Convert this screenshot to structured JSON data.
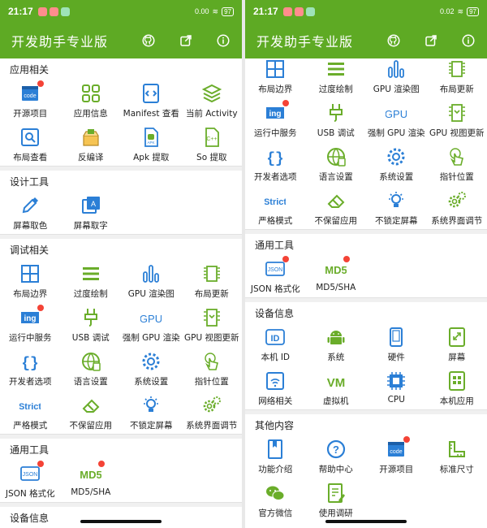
{
  "status_bar": {
    "time": "21:17",
    "battery": "97",
    "speed_left": "0.00",
    "speed_right": "0.02"
  },
  "app": {
    "title": "开发助手专业版"
  },
  "colors": {
    "brand": "#5eaa24",
    "blue": "#2b7fd6",
    "green": "#6aad2a",
    "red": "#f44336"
  },
  "icons": {
    "github": "github-icon",
    "share": "share-icon",
    "info": "info-icon"
  },
  "left": {
    "sections": [
      {
        "title": "应用相关",
        "items": [
          {
            "label": "开源项目",
            "icon": "code"
          },
          {
            "label": "应用信息",
            "icon": "grid"
          },
          {
            "label": "Manifest 查看",
            "icon": "manifest"
          },
          {
            "label": "当前 Activity",
            "icon": "layers"
          },
          {
            "label": "布局查看",
            "icon": "search"
          },
          {
            "label": "反编译",
            "icon": "box"
          },
          {
            "label": "Apk 提取",
            "icon": "apk"
          },
          {
            "label": "So 提取",
            "icon": "cpp"
          }
        ]
      },
      {
        "title": "设计工具",
        "items": [
          {
            "label": "屏幕取色",
            "icon": "picker"
          },
          {
            "label": "屏幕取字",
            "icon": "textpick"
          }
        ]
      },
      {
        "title": "调试相关",
        "items": [
          {
            "label": "布局边界",
            "icon": "bounds"
          },
          {
            "label": "过度绘制",
            "icon": "bars"
          },
          {
            "label": "GPU 渲染图",
            "icon": "gpuchart"
          },
          {
            "label": "布局更新",
            "icon": "layoutupdate"
          },
          {
            "label": "运行中服务",
            "icon": "ing"
          },
          {
            "label": "USB 调试",
            "icon": "usb"
          },
          {
            "label": "强制 GPU 渲染",
            "icon": "gpu"
          },
          {
            "label": "GPU 视图更新",
            "icon": "gpuview"
          },
          {
            "label": "开发者选项",
            "icon": "braces"
          },
          {
            "label": "语言设置",
            "icon": "globe"
          },
          {
            "label": "系统设置",
            "icon": "gear"
          },
          {
            "label": "指针位置",
            "icon": "pointer"
          },
          {
            "label": "严格模式",
            "icon": "strict"
          },
          {
            "label": "不保留应用",
            "icon": "eraser"
          },
          {
            "label": "不锁定屏幕",
            "icon": "bulb"
          },
          {
            "label": "系统界面调节",
            "icon": "gears"
          }
        ]
      },
      {
        "title": "通用工具",
        "items": [
          {
            "label": "JSON 格式化",
            "icon": "json"
          },
          {
            "label": "MD5/SHA",
            "icon": "md5"
          }
        ]
      },
      {
        "title": "设备信息",
        "items": []
      }
    ]
  },
  "right": {
    "sections": [
      {
        "title": "",
        "items": [
          {
            "label": "布局边界",
            "icon": "bounds"
          },
          {
            "label": "过度绘制",
            "icon": "bars"
          },
          {
            "label": "GPU 渲染图",
            "icon": "gpuchart"
          },
          {
            "label": "布局更新",
            "icon": "layoutupdate"
          },
          {
            "label": "运行中服务",
            "icon": "ing"
          },
          {
            "label": "USB 调试",
            "icon": "usb"
          },
          {
            "label": "强制 GPU 渲染",
            "icon": "gpu"
          },
          {
            "label": "GPU 视图更新",
            "icon": "gpuview"
          },
          {
            "label": "开发者选项",
            "icon": "braces"
          },
          {
            "label": "语言设置",
            "icon": "globe"
          },
          {
            "label": "系统设置",
            "icon": "gear"
          },
          {
            "label": "指针位置",
            "icon": "pointer"
          },
          {
            "label": "严格模式",
            "icon": "strict"
          },
          {
            "label": "不保留应用",
            "icon": "eraser"
          },
          {
            "label": "不锁定屏幕",
            "icon": "bulb"
          },
          {
            "label": "系统界面调节",
            "icon": "gears"
          }
        ]
      },
      {
        "title": "通用工具",
        "items": [
          {
            "label": "JSON 格式化",
            "icon": "json"
          },
          {
            "label": "MD5/SHA",
            "icon": "md5"
          }
        ]
      },
      {
        "title": "设备信息",
        "items": [
          {
            "label": "本机 ID",
            "icon": "id"
          },
          {
            "label": "系统",
            "icon": "android"
          },
          {
            "label": "硬件",
            "icon": "phone"
          },
          {
            "label": "屏幕",
            "icon": "screen"
          },
          {
            "label": "网络相关",
            "icon": "network"
          },
          {
            "label": "虚拟机",
            "icon": "vm"
          },
          {
            "label": "CPU",
            "icon": "cpu"
          },
          {
            "label": "本机应用",
            "icon": "apps"
          }
        ]
      },
      {
        "title": "其他内容",
        "items": [
          {
            "label": "功能介绍",
            "icon": "book"
          },
          {
            "label": "帮助中心",
            "icon": "help"
          },
          {
            "label": "开源项目",
            "icon": "code"
          },
          {
            "label": "标准尺寸",
            "icon": "ruler"
          },
          {
            "label": "官方微信",
            "icon": "wechat"
          },
          {
            "label": "使用调研",
            "icon": "survey"
          }
        ]
      }
    ]
  }
}
